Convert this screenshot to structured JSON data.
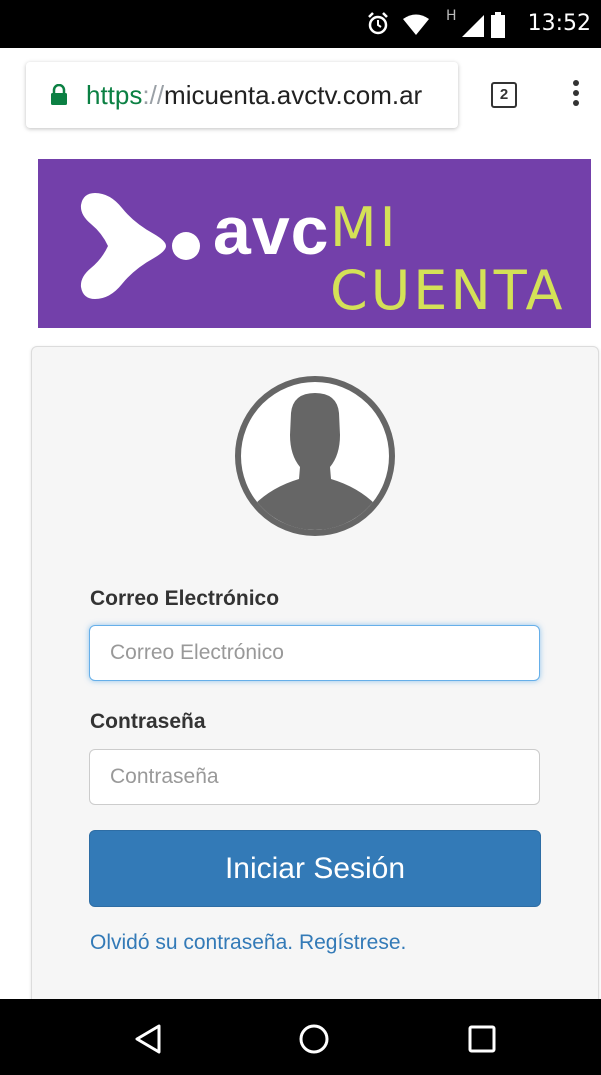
{
  "status_bar": {
    "time": "13:52",
    "network_label": "H",
    "icons": [
      "alarm-icon",
      "wifi-icon",
      "signal-icon",
      "battery-icon"
    ]
  },
  "browser": {
    "url_scheme": "https",
    "url_separator": "://",
    "url_host": "micuenta.avctv.com.ar",
    "tab_count": "2"
  },
  "banner": {
    "brand": "avc",
    "tagline": "MI CUENTA",
    "background_color": "#7340aa",
    "tagline_color": "#d4e157"
  },
  "login": {
    "email_label": "Correo Electrónico",
    "email_placeholder": "Correo Electrónico",
    "email_value": "",
    "password_label": "Contraseña",
    "password_placeholder": "Contraseña",
    "password_value": "",
    "submit_label": "Iniciar Sesión",
    "forgot_link": "Olvidó su contraseña.",
    "register_link": "Regístrese.",
    "accent_color": "#337ab7"
  },
  "nav_bar": {
    "buttons": [
      "back-icon",
      "home-icon",
      "recents-icon"
    ]
  }
}
